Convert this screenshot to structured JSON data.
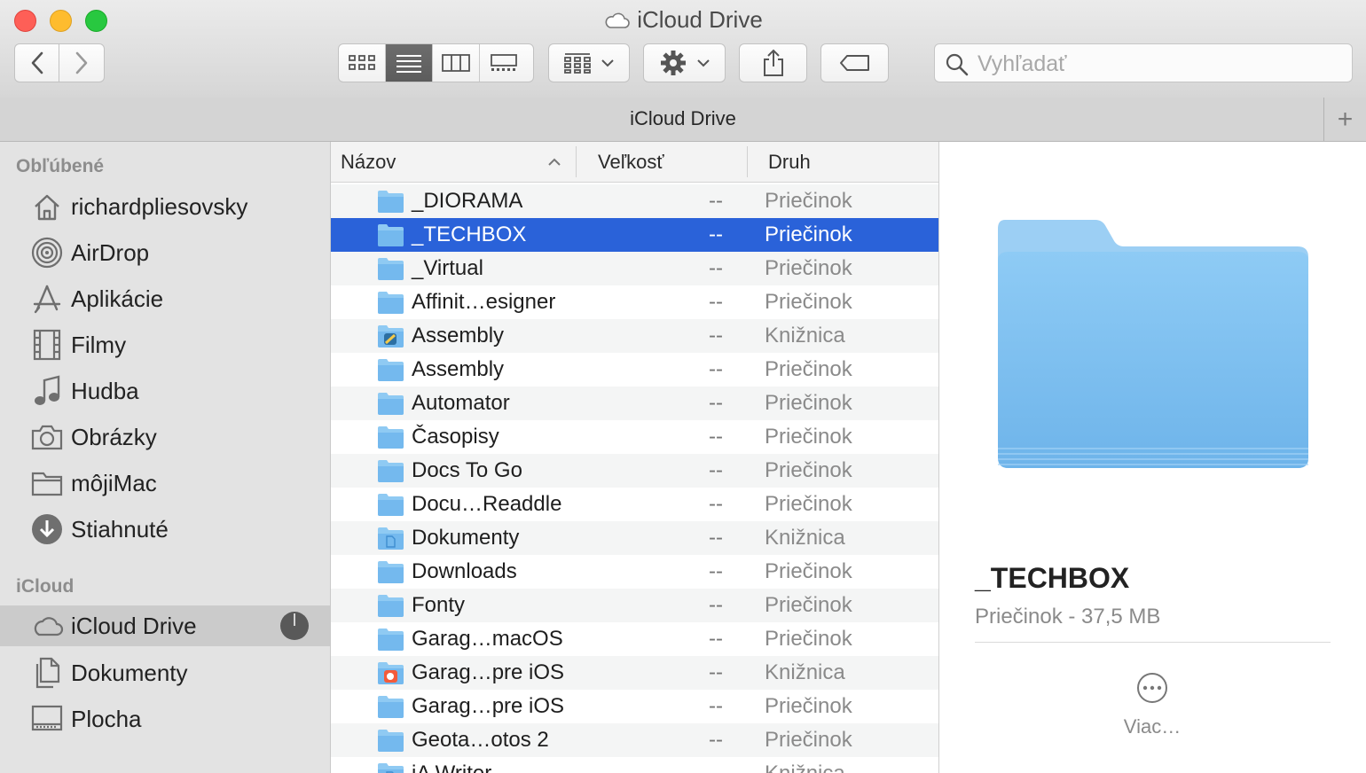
{
  "window": {
    "title": "iCloud Drive"
  },
  "toolbar": {
    "back_icon": "chevron-left-icon",
    "forward_icon": "chevron-right-icon",
    "view_modes": [
      "icon-view",
      "list-view",
      "column-view",
      "gallery-view"
    ],
    "active_view": "list-view",
    "group_icon": "group-grid-icon",
    "action_icon": "gear-icon",
    "share_icon": "share-icon",
    "tag_icon": "tag-icon",
    "search_placeholder": "Vyhľadať"
  },
  "pathbar": {
    "title": "iCloud Drive",
    "add_label": "+"
  },
  "sidebar": {
    "favorites_header": "Obľúbené",
    "favorites": [
      {
        "label": "richardpliesovsky",
        "icon": "home-icon"
      },
      {
        "label": "AirDrop",
        "icon": "airdrop-icon"
      },
      {
        "label": "Aplikácie",
        "icon": "applications-icon"
      },
      {
        "label": "Filmy",
        "icon": "film-icon"
      },
      {
        "label": "Hudba",
        "icon": "music-note-icon"
      },
      {
        "label": "Obrázky",
        "icon": "camera-icon"
      },
      {
        "label": "môjiMac",
        "icon": "folder-icon"
      },
      {
        "label": "Stiahnuté",
        "icon": "download-icon"
      }
    ],
    "icloud_header": "iCloud",
    "icloud": [
      {
        "label": "iCloud Drive",
        "icon": "cloud-icon",
        "selected": true
      },
      {
        "label": "Dokumenty",
        "icon": "documents-icon"
      },
      {
        "label": "Plocha",
        "icon": "desktop-icon"
      }
    ]
  },
  "list": {
    "columns": {
      "name": "Názov",
      "size": "Veľkosť",
      "kind": "Druh"
    },
    "rows": [
      {
        "name": "_DIORAMA",
        "size": "--",
        "kind": "Priečinok",
        "icon": "folder"
      },
      {
        "name": "_TECHBOX",
        "size": "--",
        "kind": "Priečinok",
        "icon": "folder",
        "selected": true
      },
      {
        "name": "_Virtual",
        "size": "--",
        "kind": "Priečinok",
        "icon": "folder"
      },
      {
        "name": "Affinit…esigner",
        "size": "--",
        "kind": "Priečinok",
        "icon": "folder"
      },
      {
        "name": "Assembly",
        "size": "--",
        "kind": "Knižnica",
        "icon": "app-folder"
      },
      {
        "name": "Assembly",
        "size": "--",
        "kind": "Priečinok",
        "icon": "folder"
      },
      {
        "name": "Automator",
        "size": "--",
        "kind": "Priečinok",
        "icon": "folder"
      },
      {
        "name": "Časopisy",
        "size": "--",
        "kind": "Priečinok",
        "icon": "folder"
      },
      {
        "name": "Docs To Go",
        "size": "--",
        "kind": "Priečinok",
        "icon": "folder"
      },
      {
        "name": "Docu…Readdle",
        "size": "--",
        "kind": "Priečinok",
        "icon": "folder"
      },
      {
        "name": "Dokumenty",
        "size": "--",
        "kind": "Knižnica",
        "icon": "doc-folder"
      },
      {
        "name": "Downloads",
        "size": "--",
        "kind": "Priečinok",
        "icon": "folder"
      },
      {
        "name": "Fonty",
        "size": "--",
        "kind": "Priečinok",
        "icon": "folder"
      },
      {
        "name": "Garag…macOS",
        "size": "--",
        "kind": "Priečinok",
        "icon": "folder"
      },
      {
        "name": "Garag…pre iOS",
        "size": "--",
        "kind": "Knižnica",
        "icon": "garageband-folder"
      },
      {
        "name": "Garag…pre iOS",
        "size": "--",
        "kind": "Priečinok",
        "icon": "folder"
      },
      {
        "name": "Geota…otos 2",
        "size": "--",
        "kind": "Priečinok",
        "icon": "folder"
      },
      {
        "name": "iA Writer",
        "size": "--",
        "kind": "Knižnica",
        "icon": "doc-folder"
      }
    ]
  },
  "preview": {
    "name": "_TECHBOX",
    "info": "Priečinok - 37,5 MB",
    "more_label": "Viac…",
    "more_icon": "ellipsis-circle-icon"
  },
  "colors": {
    "selection": "#2a62d9",
    "folder": "#74b9ee"
  }
}
